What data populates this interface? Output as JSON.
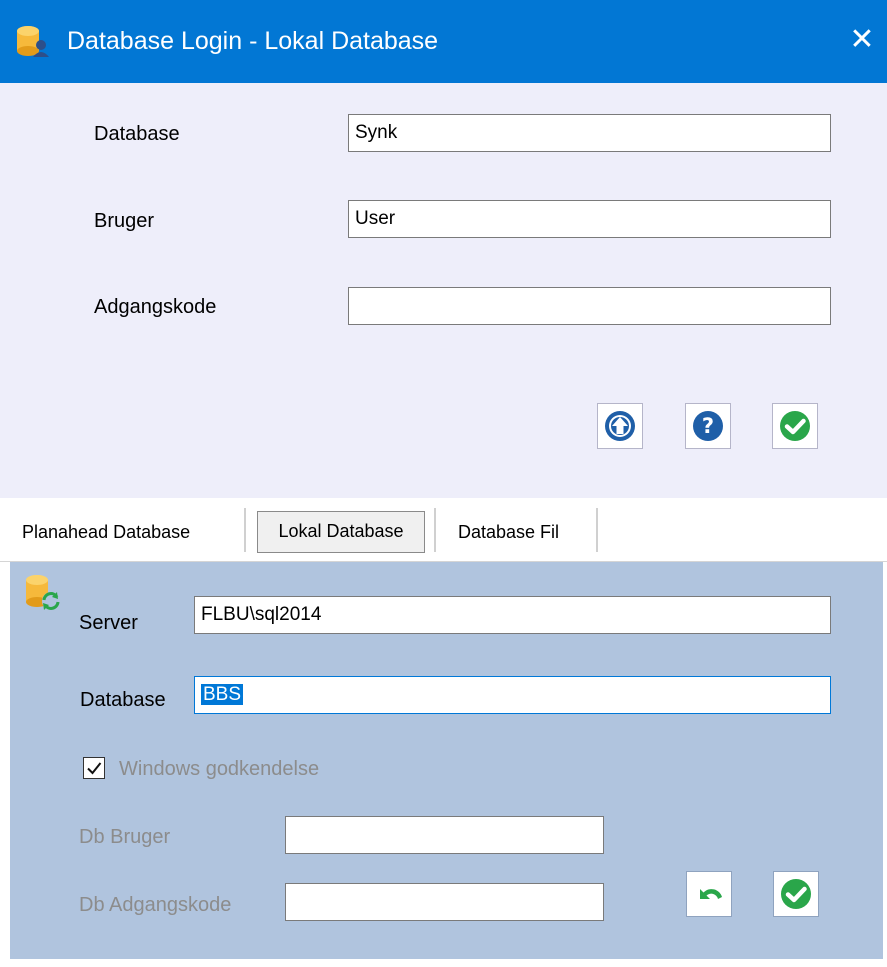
{
  "window": {
    "title": "Database Login - Lokal Database",
    "close_glyph": "✕",
    "icon": "database-user-icon"
  },
  "login": {
    "database_label": "Database",
    "database_value": "Synk",
    "user_label": "Bruger",
    "user_value": "User",
    "password_label": "Adgangskode",
    "password_value": "",
    "buttons": [
      "upload-icon",
      "help-icon",
      "confirm-icon"
    ]
  },
  "tabs": [
    {
      "label": "Planahead Database"
    },
    {
      "label": "Lokal Database",
      "active": true
    },
    {
      "label": "Database Fil"
    }
  ],
  "local": {
    "server_label": "Server",
    "server_value": "FLBU\\sql2014",
    "database_label": "Database",
    "database_value": "BBS",
    "windows_auth_label": "Windows godkendelse",
    "windows_auth_checked": true,
    "db_user_label": "Db Bruger",
    "db_user_value": "",
    "db_password_label": "Db Adgangskode",
    "db_password_value": "",
    "buttons": [
      "undo-icon",
      "confirm-icon"
    ]
  },
  "colors": {
    "titlebar": "#0277d4",
    "top_panel": "#eeeefa",
    "lower_panel": "#b0c4de",
    "accent_blue": "#1f5fa8",
    "accent_green": "#2aa64a"
  }
}
